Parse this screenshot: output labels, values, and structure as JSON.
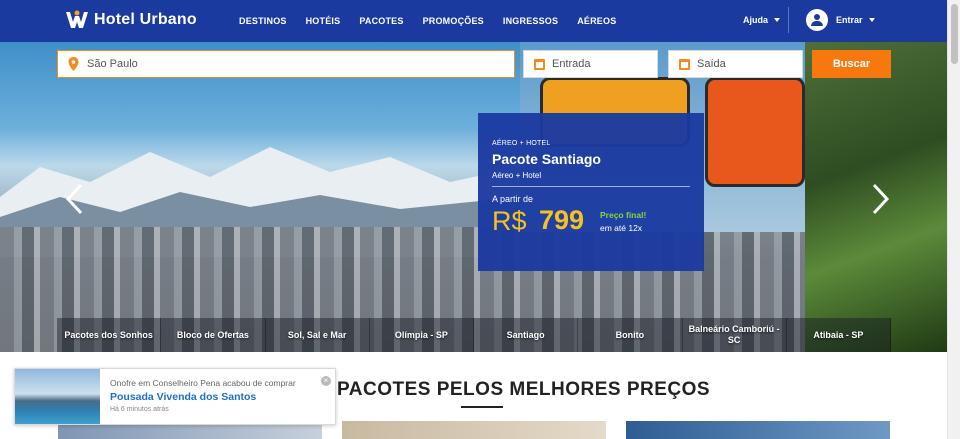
{
  "header": {
    "brand": "Hotel Urbano",
    "nav": [
      "DESTINOS",
      "HOTÉIS",
      "PACOTES",
      "PROMOÇÕES",
      "INGRESSOS",
      "AÉREOS"
    ],
    "help_label": "Ajuda",
    "login_label": "Entrar",
    "brand_color": "#1b3aa0"
  },
  "search": {
    "destination_value": "São Paulo",
    "checkin_placeholder": "Entrada",
    "checkout_placeholder": "Saída",
    "button_label": "Buscar",
    "accent_color": "#f7780f"
  },
  "promo": {
    "kicker": "AÉREO + HOTEL",
    "title": "Pacote Santiago",
    "subtitle": "Aéreo + Hotel",
    "from_label": "A partir de",
    "currency": "R$",
    "price": "799",
    "final_label": "Preço final!",
    "installments": "em até 12x"
  },
  "strip": [
    "Pacotes dos Sonhos",
    "Bloco de Ofertas",
    "Sol, Sal e Mar",
    "Olímpia - SP",
    "Santiago",
    "Bonito",
    "Balneário Camboriú - SC",
    "Atibaia - SP"
  ],
  "section": {
    "title": "PACOTES PELOS MELHORES PREÇOS"
  },
  "toast": {
    "line1": "Onofre em Conselheiro Pena acabou de comprar",
    "line2": "Pousada Vivenda dos Santos",
    "line3": "Há 6 minutos atrás",
    "close_icon": "close-icon"
  }
}
